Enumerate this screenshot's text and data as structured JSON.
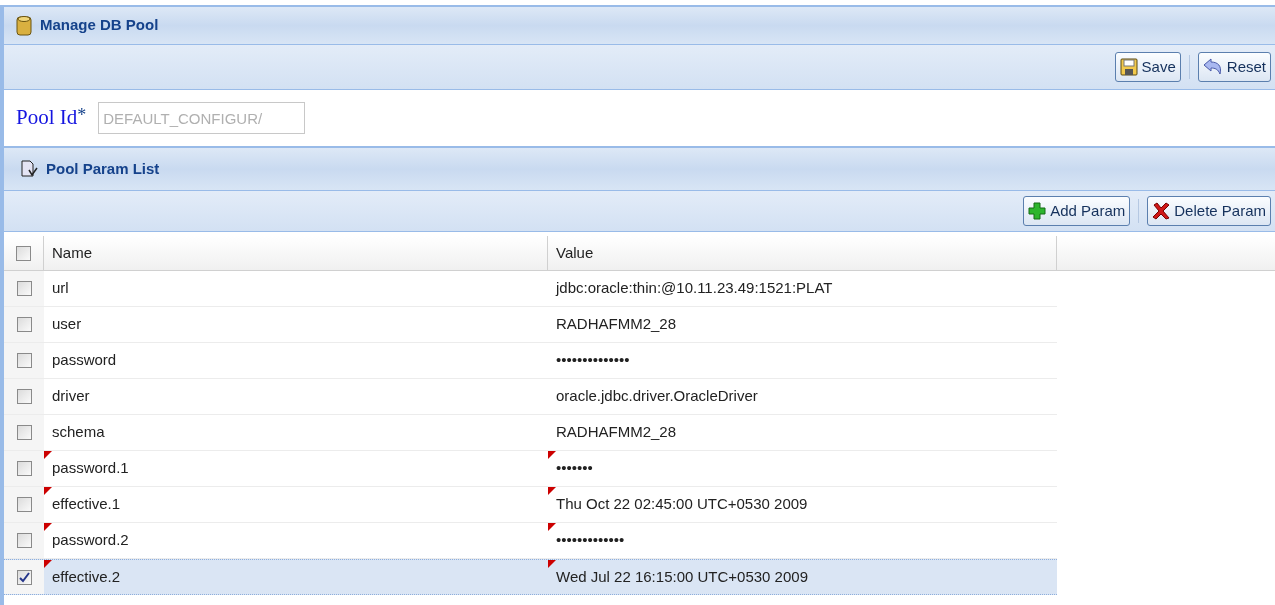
{
  "panel": {
    "title": "Manage DB Pool"
  },
  "toolbar": [
    {
      "kind": "save",
      "label": "Save"
    },
    {
      "kind": "reset",
      "label": "Reset"
    }
  ],
  "pool_id": {
    "label": "Pool Id",
    "required_mark": "*",
    "value": "DEFAULT_CONFIGUR/",
    "disabled": true
  },
  "section": {
    "title": "Pool Param List"
  },
  "section_toolbar": [
    {
      "kind": "add",
      "label": "Add Param"
    },
    {
      "kind": "delete",
      "label": "Delete Param"
    }
  ],
  "table": {
    "all_checked": false,
    "columns": [
      "Name",
      "Value"
    ],
    "rows": [
      {
        "name": "url",
        "value": "jdbc:oracle:thin:@10.11.23.49:1521:PLAT",
        "checked": false,
        "selected": false,
        "modified": false
      },
      {
        "name": "user",
        "value": "RADHAFMM2_28",
        "checked": false,
        "selected": false,
        "modified": false
      },
      {
        "name": "password",
        "value": "••••••••••••••",
        "checked": false,
        "selected": false,
        "modified": false
      },
      {
        "name": "driver",
        "value": "oracle.jdbc.driver.OracleDriver",
        "checked": false,
        "selected": false,
        "modified": false
      },
      {
        "name": "schema",
        "value": "RADHAFMM2_28",
        "checked": false,
        "selected": false,
        "modified": false
      },
      {
        "name": "password.1",
        "value": "•••••••",
        "checked": false,
        "selected": false,
        "modified": true
      },
      {
        "name": "effective.1",
        "value": "Thu Oct 22 02:45:00 UTC+0530 2009",
        "checked": false,
        "selected": false,
        "modified": true
      },
      {
        "name": "password.2",
        "value": "•••••••••••••",
        "checked": false,
        "selected": false,
        "modified": true
      },
      {
        "name": "effective.2",
        "value": "Wed Jul 22 16:15:00 UTC+0530 2009",
        "checked": true,
        "selected": true,
        "modified": true
      }
    ]
  }
}
